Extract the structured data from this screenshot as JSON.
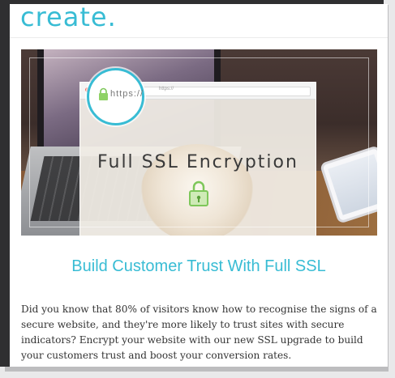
{
  "brand": {
    "logo_text": "create",
    "logo_dot": ".",
    "accent": "#38bcd4"
  },
  "hero": {
    "url_text": "https://",
    "ssl_label": "Full SSL Encryption"
  },
  "article": {
    "headline": "Build Customer Trust With Full SSL",
    "body": "Did you know that 80% of visitors know how to recognise the signs of a secure website, and they're more likely to trust sites with secure indicators? Encrypt your website with our new SSL upgrade to build your customers trust and boost your conversion rates."
  }
}
